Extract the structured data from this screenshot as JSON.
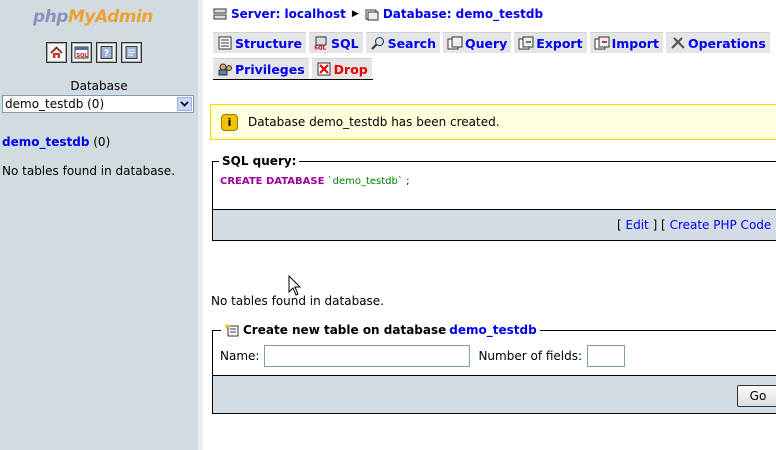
{
  "logo": {
    "part1": "php",
    "part2": "MyAdmin"
  },
  "quick_icons": [
    "home-icon",
    "sql-query-icon",
    "help-icon",
    "docs-icon"
  ],
  "sidebar": {
    "database_label": "Database",
    "selected_db": "demo_testdb (0)",
    "db_name": "demo_testdb",
    "db_count": "(0)",
    "empty_text": "No tables found in database."
  },
  "breadcrumb": {
    "server": "Server: localhost",
    "database": "Database: demo_testdb"
  },
  "tabs": [
    {
      "label": "Structure",
      "icon": "structure-icon"
    },
    {
      "label": "SQL",
      "icon": "sql-icon"
    },
    {
      "label": "Search",
      "icon": "search-icon"
    },
    {
      "label": "Query",
      "icon": "query-icon"
    },
    {
      "label": "Export",
      "icon": "export-icon"
    },
    {
      "label": "Import",
      "icon": "import-icon"
    },
    {
      "label": "Operations",
      "icon": "operations-icon"
    },
    {
      "label": "Privileges",
      "icon": "privileges-icon"
    },
    {
      "label": "Drop",
      "icon": "drop-icon"
    }
  ],
  "notice": {
    "icon_text": "i",
    "message": "Database demo_testdb has been created."
  },
  "sql_query": {
    "legend": "SQL query:",
    "keyword": "CREATE DATABASE",
    "identifier": "`demo_testdb`",
    "terminator": ";",
    "edit_label": "Edit",
    "php_label": "Create PHP Code"
  },
  "main": {
    "empty_text": "No tables found in database."
  },
  "create_table": {
    "legend": "Create new table on database",
    "db_name": "demo_testdb",
    "name_label": "Name:",
    "name_value": "",
    "fields_label": "Number of fields:",
    "fields_value": "",
    "go_label": "Go"
  },
  "colors": {
    "sidebar_bg": "#d0dce0",
    "link": "#0000ee",
    "drop": "#ee0000",
    "notice_bg": "#ffffdd",
    "footer_bg": "#d5dde4"
  }
}
